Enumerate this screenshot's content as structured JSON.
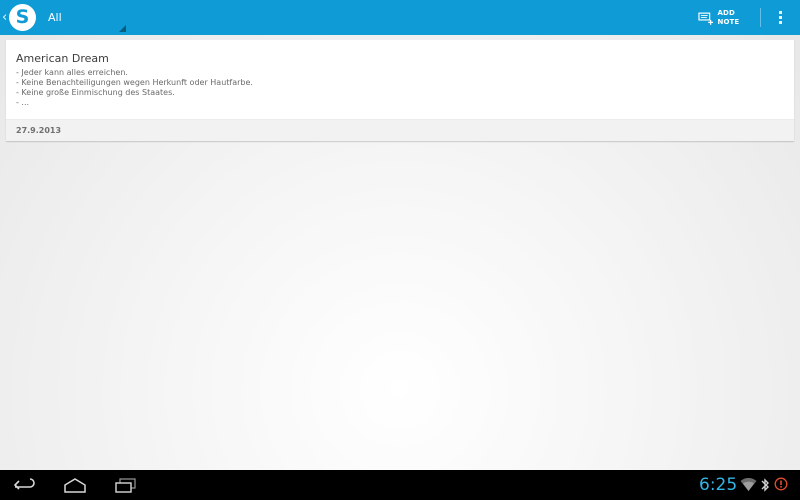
{
  "action_bar": {
    "logo_letter": "S",
    "filter_label": "All",
    "add_note_label": "ADD NOTE",
    "background_color": "#0f9bd6"
  },
  "notes": [
    {
      "title": "American Dream",
      "lines": [
        "- Jeder kann alles erreichen.",
        "- Keine Benachteiligungen wegen Herkunft oder Hautfarbe.",
        "- Keine große Einmischung des Staates.",
        "- ..."
      ],
      "date": "27.9.2013"
    }
  ],
  "system_bar": {
    "clock": "6:25",
    "clock_color": "#33b5e5",
    "icons": [
      "back-icon",
      "home-icon",
      "recent-apps-icon",
      "wifi-icon",
      "bluetooth-icon",
      "alert-icon"
    ]
  }
}
